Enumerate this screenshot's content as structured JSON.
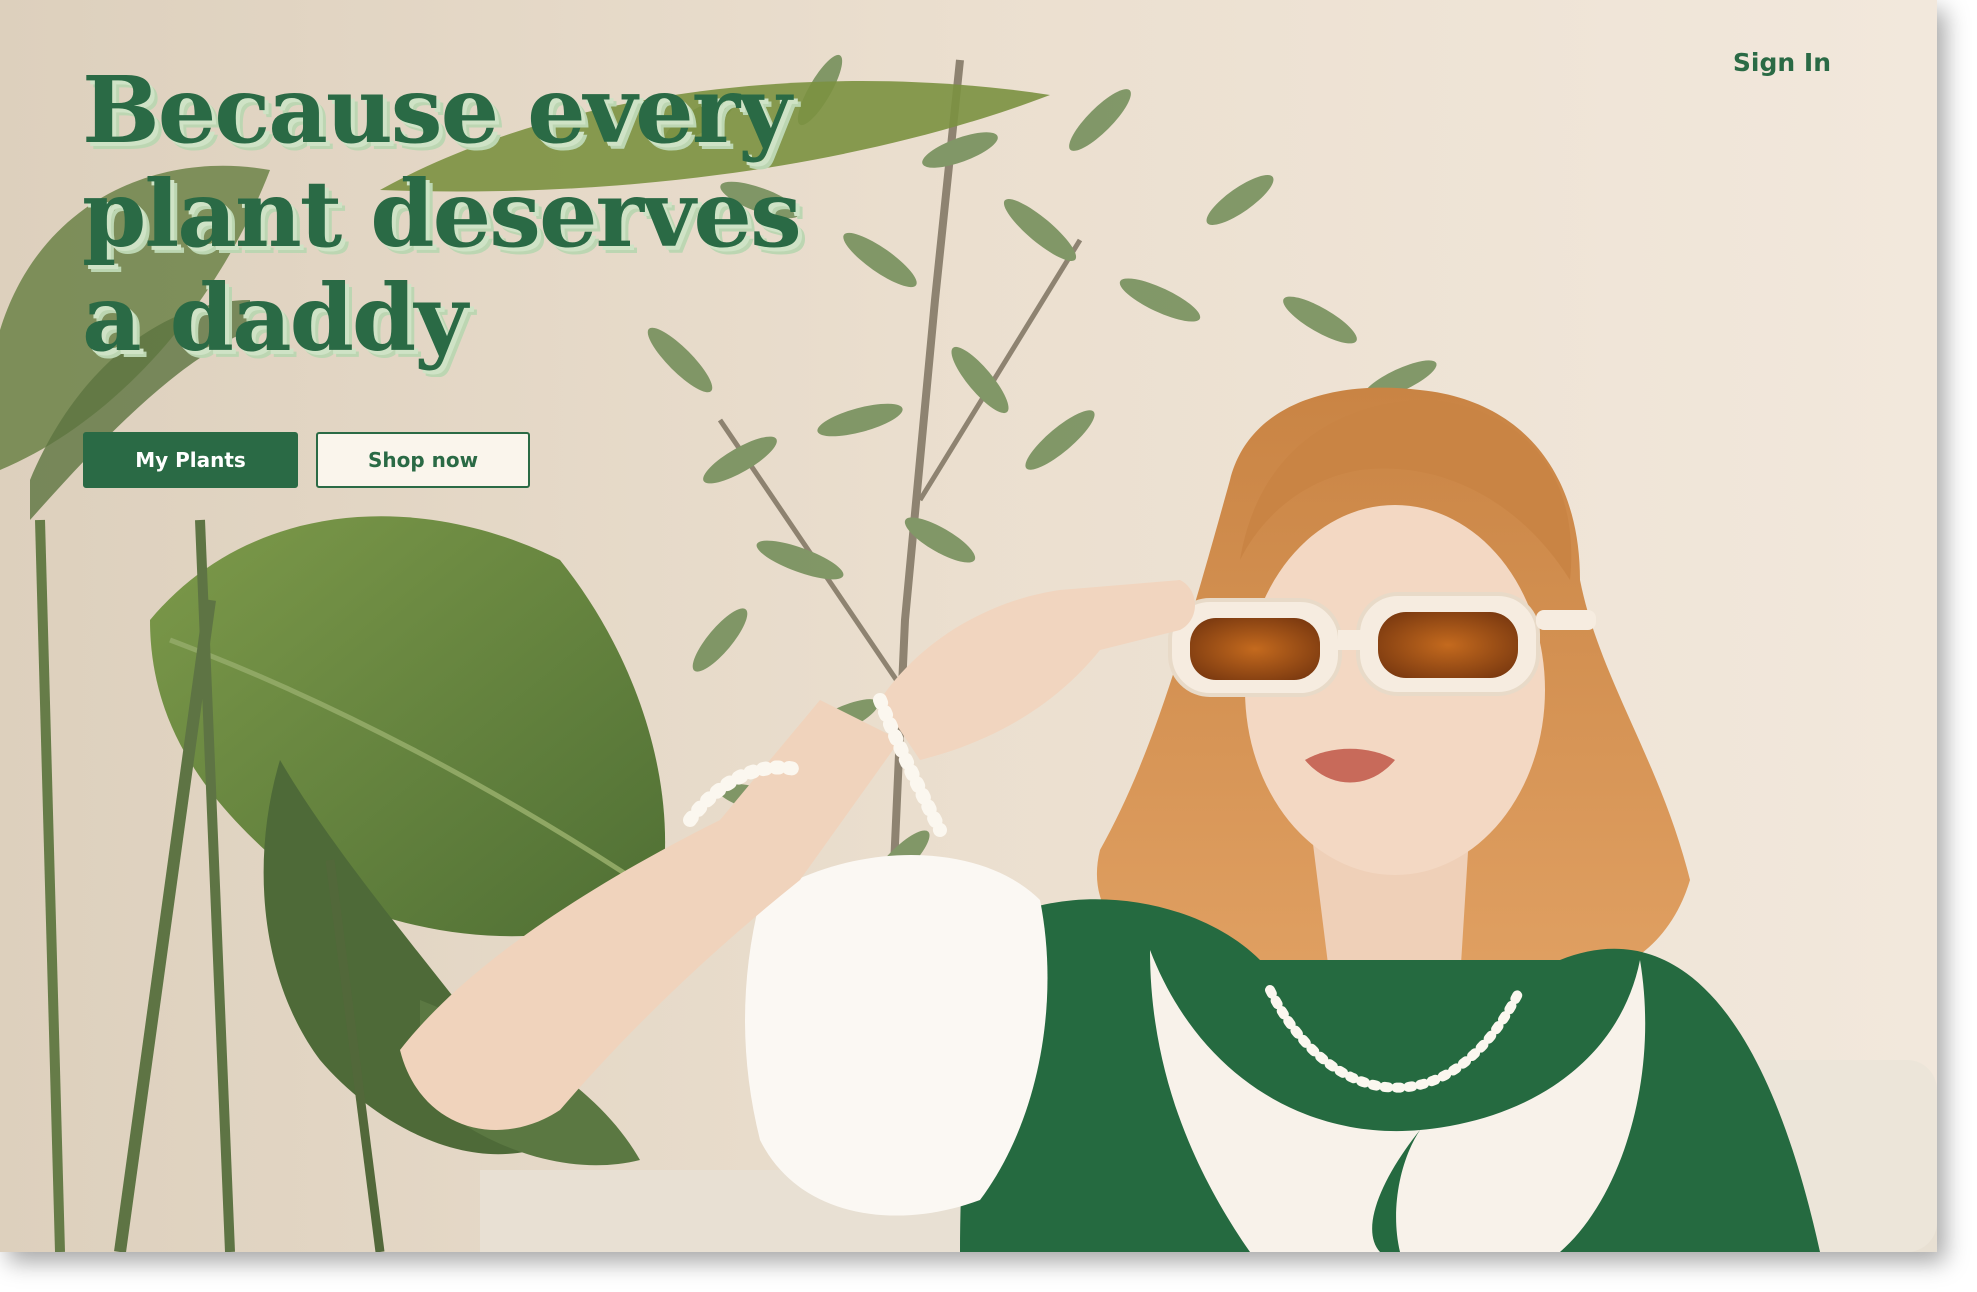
{
  "header": {
    "sign_in_label": "Sign In"
  },
  "hero": {
    "headline_lines": [
      "Because every",
      "plant deserves",
      "a daddy"
    ],
    "primary_button_label": "My Plants",
    "secondary_button_label": "Shop now",
    "image_description_icon": "hero-photo"
  },
  "colors": {
    "brand_green": "#2a6a45",
    "headline_shadow": "#cfe3c6",
    "background": "#ecdfd0",
    "button_secondary_bg": "#faf5ec"
  }
}
